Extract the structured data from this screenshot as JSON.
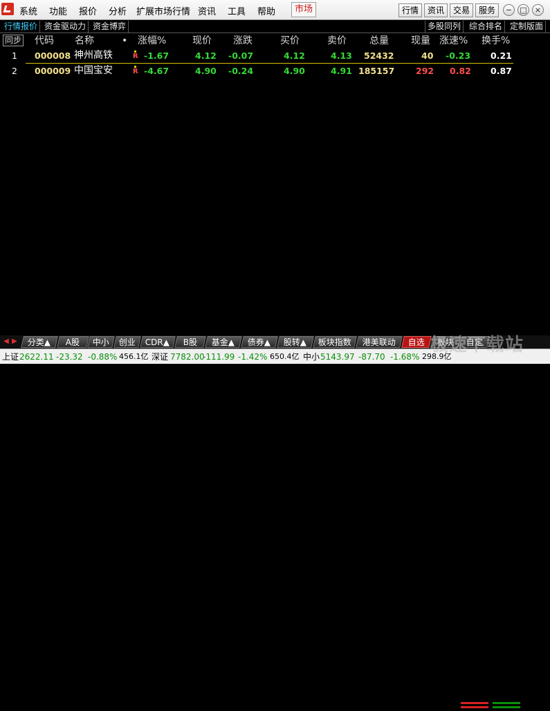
{
  "menu": {
    "items": [
      "系统",
      "功能",
      "报价",
      "分析",
      "扩展市场行情",
      "资讯",
      "工具",
      "帮助"
    ],
    "market": "市场",
    "right_buttons": [
      "行情",
      "资讯",
      "交易",
      "服务"
    ],
    "window_controls": [
      "−",
      "□",
      "×"
    ]
  },
  "subtabs": {
    "left": [
      "行情报价",
      "资金驱动力",
      "资金博弈"
    ],
    "right": [
      "多股同列",
      "综合排名",
      "定制版面"
    ]
  },
  "table": {
    "sync_button": "同步",
    "headers": [
      "代码",
      "名称",
      "•",
      "涨幅%",
      "现价",
      "涨跌",
      "买价",
      "卖价",
      "总量",
      "现量",
      "涨速%",
      "换手%"
    ],
    "rows": [
      {
        "index": "1",
        "code": "000008",
        "name": "神州高铁",
        "mark": "R",
        "change_pct": "-1.67",
        "price": "4.12",
        "change": "-0.07",
        "bid": "4.12",
        "ask": "4.13",
        "volume": "52432",
        "last_vol": "40",
        "speed": "-0.23",
        "turnover": "0.21"
      },
      {
        "index": "2",
        "code": "000009",
        "name": "中国宝安",
        "mark": "R",
        "change_pct": "-4.67",
        "price": "4.90",
        "change": "-0.24",
        "bid": "4.90",
        "ask": "4.91",
        "volume": "185157",
        "last_vol": "292",
        "speed": "0.82",
        "turnover": "0.87"
      }
    ]
  },
  "bottom_tabs": [
    "分类▲",
    "A股",
    "中小",
    "创业",
    "CDR▲",
    "B股",
    "基金▲",
    "债券▲",
    "股转▲",
    "板块指数",
    "港美联动",
    "自选",
    "板块",
    "自定"
  ],
  "bottom_active": "自选",
  "status": {
    "sh_label": "上证",
    "sh_value": "2622.11",
    "sh_change": "-23.32",
    "sh_pct": "-0.88%",
    "sh_amount": "456.1亿",
    "sz_label": "深证",
    "sz_value": "7782.00",
    "sz_change": "-111.99",
    "sz_pct": "-1.42%",
    "sz_amount": "650.4亿",
    "zx_label": "中小",
    "zx_value": "5143.97",
    "zx_change": "-87.70",
    "zx_pct": "-1.68%",
    "zx_amount": "298.9亿"
  },
  "watermark": "极速下载站",
  "colors": {
    "up": "#ff4d4d",
    "down": "#36d936",
    "code": "#f2e08a",
    "name": "#ffffff",
    "neutral_price": "#36d936",
    "volume": "#f2e08a"
  }
}
